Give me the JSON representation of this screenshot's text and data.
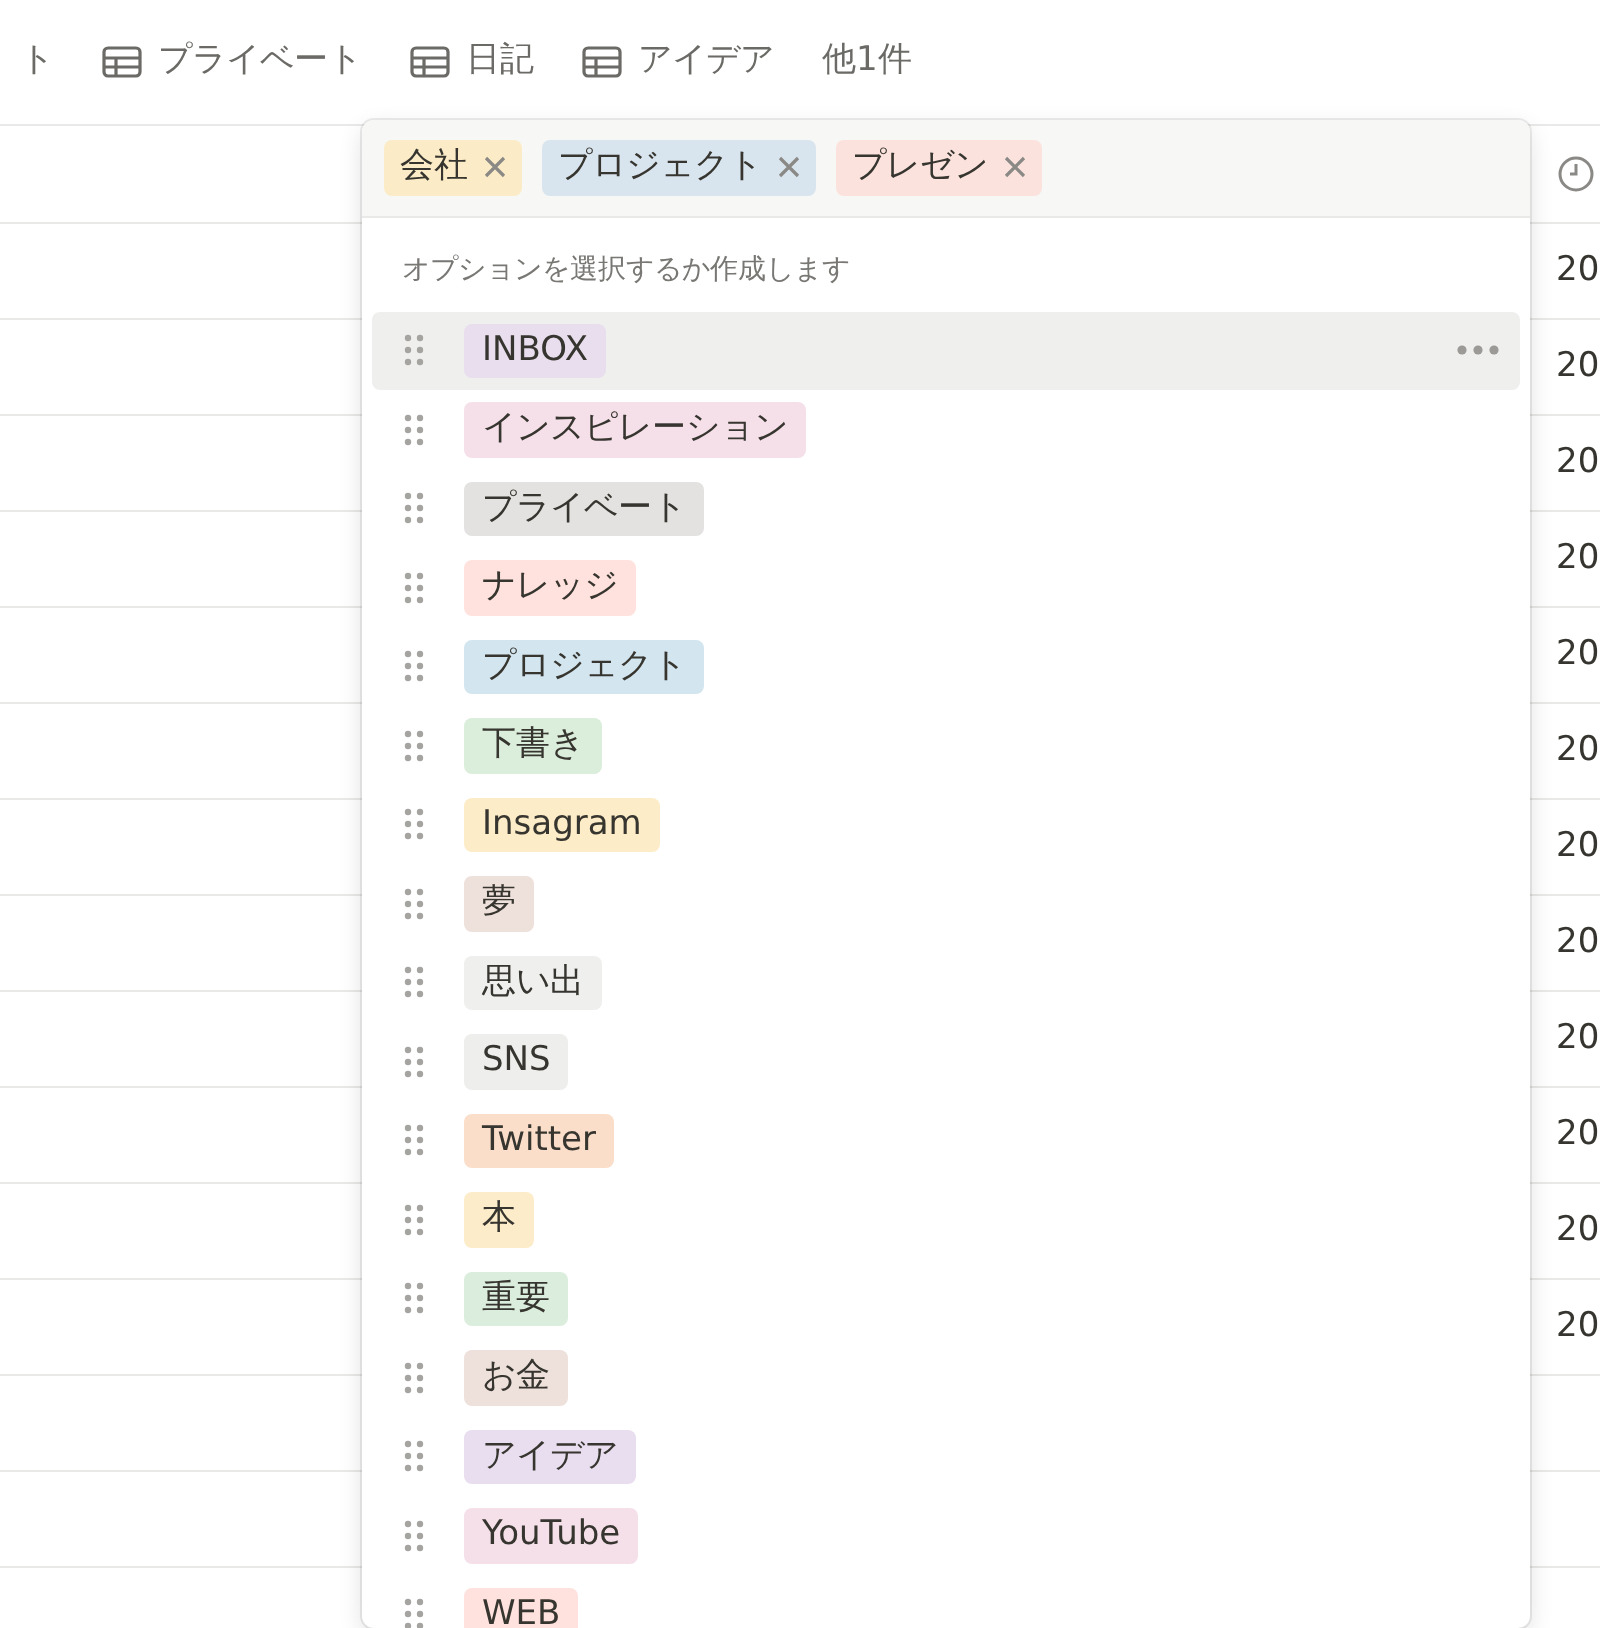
{
  "view_tabs": [
    {
      "label": "ト",
      "icon": false
    },
    {
      "label": "プライベート",
      "icon": true
    },
    {
      "label": "日記",
      "icon": true
    },
    {
      "label": "アイデア",
      "icon": true
    },
    {
      "label": "他1件",
      "icon": false
    }
  ],
  "table": {
    "rows": [
      "20",
      "20",
      "20",
      "20",
      "20",
      "20",
      "20",
      "20",
      "20",
      "20",
      "20",
      "20",
      "",
      ""
    ]
  },
  "tag_picker": {
    "selected_tags": [
      {
        "label": "会社",
        "color": "#fbecc7"
      },
      {
        "label": "プロジェクト",
        "color": "#d9e5ee"
      },
      {
        "label": "プレゼン",
        "color": "#fbe2dd"
      }
    ],
    "hint": "オプションを選択するか作成します",
    "options": [
      {
        "label": "INBOX",
        "color": "#e8deee",
        "selected": true
      },
      {
        "label": "インスピレーション",
        "color": "#f5e0e9",
        "selected": false
      },
      {
        "label": "プライベート",
        "color": "#e3e2e0",
        "selected": false
      },
      {
        "label": "ナレッジ",
        "color": "#ffe2dd",
        "selected": false
      },
      {
        "label": "プロジェクト",
        "color": "#d3e5ef",
        "selected": false
      },
      {
        "label": "下書き",
        "color": "#dbeddb",
        "selected": false
      },
      {
        "label": "Insagram",
        "color": "#fdecc8",
        "selected": false
      },
      {
        "label": "夢",
        "color": "#eee0da",
        "selected": false
      },
      {
        "label": "思い出",
        "color": "#efefee",
        "selected": false
      },
      {
        "label": "SNS",
        "color": "#eeeeed",
        "selected": false
      },
      {
        "label": "Twitter",
        "color": "#fadec9",
        "selected": false
      },
      {
        "label": "本",
        "color": "#fdecc9",
        "selected": false
      },
      {
        "label": "重要",
        "color": "#dbeddc",
        "selected": false
      },
      {
        "label": "お金",
        "color": "#eee0db",
        "selected": false
      },
      {
        "label": "アイデア",
        "color": "#e8deef",
        "selected": false
      },
      {
        "label": "YouTube",
        "color": "#f5e0ea",
        "selected": false
      },
      {
        "label": "WEB",
        "color": "#ffe2de",
        "selected": false
      }
    ]
  }
}
